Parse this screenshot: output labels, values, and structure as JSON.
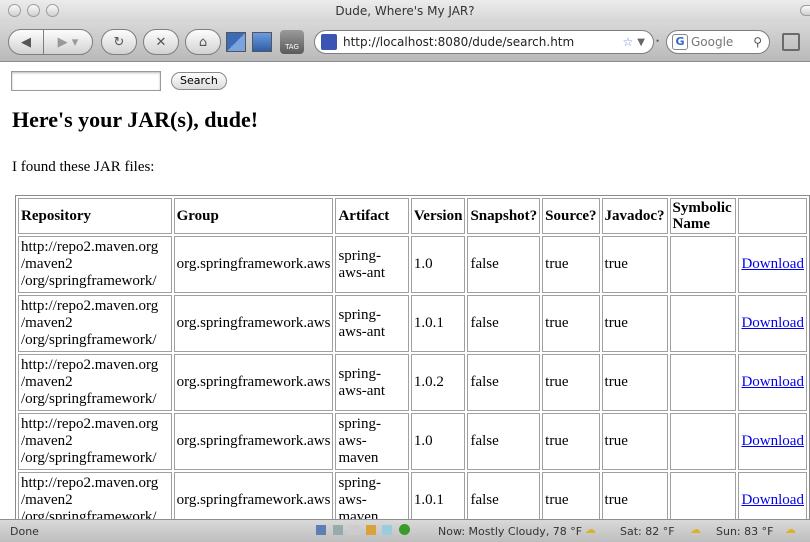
{
  "window": {
    "title": "Dude, Where's My JAR?"
  },
  "toolbar": {
    "url": "http://localhost:8080/dude/search.htm",
    "search_engine": "Google",
    "tag_label": "TAG"
  },
  "search": {
    "value": "",
    "button_label": "Search"
  },
  "page": {
    "heading": "Here's your JAR(s), dude!",
    "intro": "I found these JAR files:"
  },
  "table": {
    "headers": [
      "Repository",
      "Group",
      "Artifact",
      "Version",
      "Snapshot?",
      "Source?",
      "Javadoc?",
      "Symbolic Name",
      ""
    ],
    "rows": [
      {
        "repo": [
          "http://repo2.maven.org",
          "/maven2",
          "/org/springframework/"
        ],
        "group": "org.springframework.aws",
        "artifact": [
          "spring-",
          "aws-ant"
        ],
        "version": "1.0",
        "snapshot": "false",
        "source": "true",
        "javadoc": "true",
        "symbolic": "",
        "link": "Download"
      },
      {
        "repo": [
          "http://repo2.maven.org",
          "/maven2",
          "/org/springframework/"
        ],
        "group": "org.springframework.aws",
        "artifact": [
          "spring-",
          "aws-ant"
        ],
        "version": "1.0.1",
        "snapshot": "false",
        "source": "true",
        "javadoc": "true",
        "symbolic": "",
        "link": "Download"
      },
      {
        "repo": [
          "http://repo2.maven.org",
          "/maven2",
          "/org/springframework/"
        ],
        "group": "org.springframework.aws",
        "artifact": [
          "spring-",
          "aws-ant"
        ],
        "version": "1.0.2",
        "snapshot": "false",
        "source": "true",
        "javadoc": "true",
        "symbolic": "",
        "link": "Download"
      },
      {
        "repo": [
          "http://repo2.maven.org",
          "/maven2",
          "/org/springframework/"
        ],
        "group": "org.springframework.aws",
        "artifact": [
          "spring-",
          "aws-maven"
        ],
        "version": "1.0",
        "snapshot": "false",
        "source": "true",
        "javadoc": "true",
        "symbolic": "",
        "link": "Download"
      },
      {
        "repo": [
          "http://repo2.maven.org",
          "/maven2",
          "/org/springframework/"
        ],
        "group": "org.springframework.aws",
        "artifact": [
          "spring-",
          "aws-maven"
        ],
        "version": "1.0.1",
        "snapshot": "false",
        "source": "true",
        "javadoc": "true",
        "symbolic": "",
        "link": "Download"
      }
    ]
  },
  "status": {
    "text": "Done",
    "weather_now": "Now: Mostly Cloudy, 78 °F",
    "weather_sat": "Sat: 82 °F",
    "weather_sun": "Sun: 83 °F"
  },
  "colors": {
    "link": "#0000ee",
    "chrome": "#c8c8c8",
    "firefox_icon": "#3a55b4"
  },
  "icons": [
    "back-icon",
    "forward-icon",
    "reload-icon",
    "stop-icon",
    "home-icon",
    "bookmark-icon",
    "tag-icon",
    "star-icon",
    "search-icon",
    "weather-icon"
  ]
}
